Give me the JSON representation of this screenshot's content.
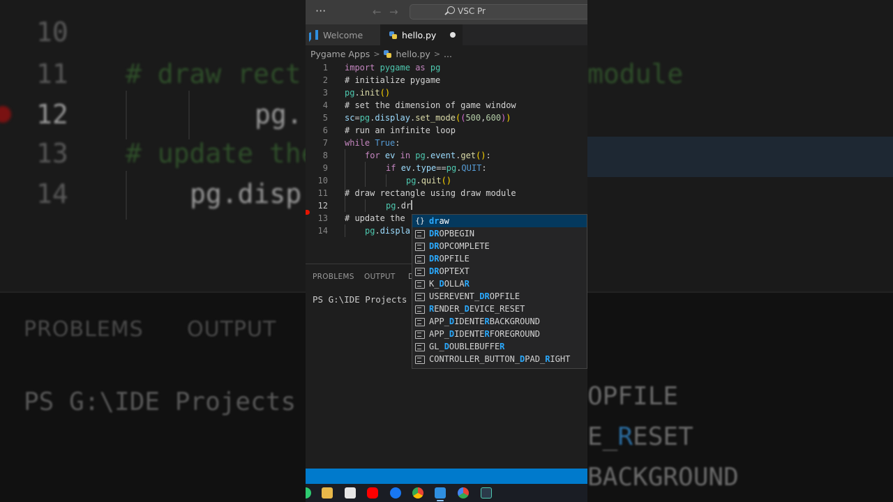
{
  "background": {
    "lines": [
      {
        "num": "10",
        "text": ""
      },
      {
        "num": "11",
        "text": "# draw rect"
      },
      {
        "num": "12",
        "text": "pg."
      },
      {
        "num": "13",
        "text": "# update the"
      },
      {
        "num": "14",
        "text": "pg.disp"
      }
    ],
    "right_text": "module",
    "panel_tabs": [
      "PROBLEMS",
      "OUTPUT"
    ],
    "terminal": "PS G:\\IDE Projects",
    "suggestions": [
      {
        "pre": "",
        "match": "",
        "post": "OPFILE"
      },
      {
        "pre": "E_",
        "match": "R",
        "post": "ESET"
      },
      {
        "pre": "",
        "match": "",
        "post": "BACKGROUND"
      }
    ]
  },
  "titlebar": {
    "more_label": "···",
    "back_label": "←",
    "forward_label": "→",
    "search_text": "VSC Pr",
    "search_icon": "search-icon"
  },
  "tabs": [
    {
      "label": "Welcome",
      "icon": "vscode-icon",
      "active": false
    },
    {
      "label": "hello.py",
      "icon": "python-file-icon",
      "active": true,
      "modified": true
    }
  ],
  "breadcrumb": {
    "folder": "Pygame Apps",
    "file": "hello.py",
    "rest": "..."
  },
  "editor": {
    "active_line": 12,
    "lines": [
      {
        "num": "1"
      },
      {
        "num": "2",
        "t1": "# initialize pygame"
      },
      {
        "num": "3"
      },
      {
        "num": "4",
        "t1": "# set the dimension of game window"
      },
      {
        "num": "5"
      },
      {
        "num": "6",
        "t1": "# run an infinite loop"
      },
      {
        "num": "7"
      },
      {
        "num": "8"
      },
      {
        "num": "9"
      },
      {
        "num": "10"
      },
      {
        "num": "11",
        "t1": "# draw rectangle using draw module"
      },
      {
        "num": "12"
      },
      {
        "num": "13",
        "t1": "# update the"
      },
      {
        "num": "14"
      }
    ],
    "tokens": {
      "l1": [
        "import",
        "pygame",
        "as",
        "pg"
      ],
      "l3": [
        "pg",
        ".",
        "init",
        "(",
        ")"
      ],
      "l5": [
        "sc",
        "=",
        "pg",
        ".",
        "display",
        ".",
        "set_mode",
        "(",
        "(",
        "500",
        ",",
        "600",
        ")",
        ")"
      ],
      "l7": [
        "while",
        "True",
        ":"
      ],
      "l8": [
        "for",
        "ev",
        "in",
        "pg",
        ".",
        "event",
        ".",
        "get",
        "(",
        ")",
        ":"
      ],
      "l9": [
        "if",
        "ev",
        ".",
        "type",
        "==",
        "pg",
        ".",
        "QUIT",
        ":"
      ],
      "l10": [
        "pg",
        ".",
        "quit",
        "(",
        ")"
      ],
      "l12": [
        "pg",
        ".",
        "dr"
      ],
      "l14": [
        "pg",
        ".",
        "displa"
      ]
    }
  },
  "suggest": [
    {
      "icon": "{}",
      "kind": "module",
      "pre": "",
      "match": "dr",
      "post": "aw",
      "selected": true
    },
    {
      "kind": "keyword",
      "pre": "",
      "match": "DR",
      "post": "OPBEGIN"
    },
    {
      "kind": "keyword",
      "pre": "",
      "match": "DR",
      "post": "OPCOMPLETE"
    },
    {
      "kind": "keyword",
      "pre": "",
      "match": "DR",
      "post": "OPFILE"
    },
    {
      "kind": "keyword",
      "pre": "",
      "match": "DR",
      "post": "OPTEXT"
    },
    {
      "kind": "keyword",
      "pre": "K_",
      "match": "D",
      "post": "OLLA",
      "match2": "R",
      "post2": ""
    },
    {
      "kind": "keyword",
      "pre": "USEREVENT_",
      "match": "DR",
      "post": "OPFILE"
    },
    {
      "kind": "keyword",
      "pre": "",
      "match": "R",
      "post": "ENDER_",
      "match2": "D",
      "post2": "EVICE_RESET"
    },
    {
      "kind": "keyword",
      "pre": "APP_",
      "match": "D",
      "post": "IDENTE",
      "match2": "R",
      "post2": "BACKGROUND"
    },
    {
      "kind": "keyword",
      "pre": "APP_",
      "match": "D",
      "post": "IDENTE",
      "match2": "R",
      "post2": "FOREGROUND"
    },
    {
      "kind": "keyword",
      "pre": "GL_",
      "match": "D",
      "post": "OUBLEBUFFE",
      "match2": "R",
      "post2": ""
    },
    {
      "kind": "keyword",
      "pre": "CONTROLLER_BUTTON_",
      "match": "D",
      "post": "PAD_",
      "match2": "R",
      "post2": "IGHT"
    }
  ],
  "panel": {
    "tabs": [
      "PROBLEMS",
      "OUTPUT",
      "D"
    ],
    "terminal": "PS G:\\IDE Projects P"
  },
  "colors": {
    "accent": "#007acc",
    "selection": "#04395e",
    "match": "#2aaaff",
    "breakpoint": "#e51400"
  },
  "taskbar": {
    "icons": [
      "app-icon",
      "file-explorer-icon",
      "store-icon",
      "youtube-icon",
      "facebook-icon",
      "chrome-icon",
      "vscode-icon",
      "chrome-alt-icon",
      "terminal-icon"
    ]
  }
}
